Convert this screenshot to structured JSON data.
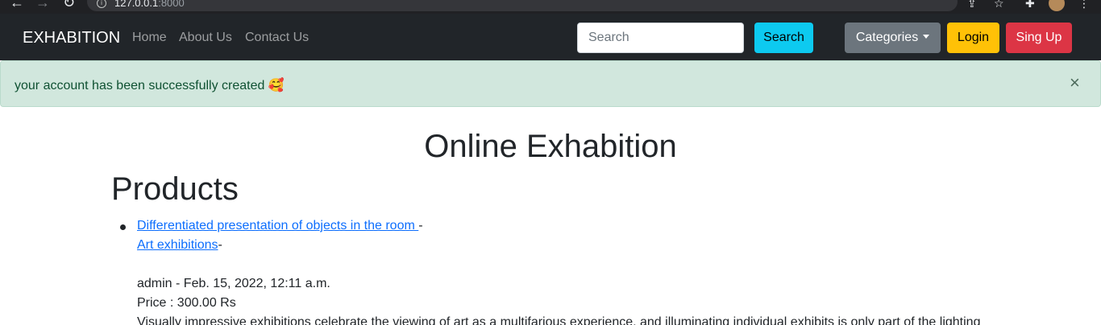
{
  "browser": {
    "url_host": "127.0.0.1",
    "url_port": ":8000"
  },
  "navbar": {
    "brand": "EXHABITION",
    "links": [
      "Home",
      "About Us",
      "Contact Us"
    ],
    "search_placeholder": "Search",
    "search_button": "Search",
    "categories_button": "Categories",
    "login_button": "Login",
    "signup_button": "Sing Up"
  },
  "alert": {
    "message": "your account has been successfully created 🥰",
    "close": "×"
  },
  "main": {
    "title": "Online Exhabition",
    "products_heading": "Products",
    "product": {
      "title_link": "Differentiated presentation of objects in the room ",
      "title_suffix": "-",
      "category_link": "Art exhibitions",
      "category_suffix": "-",
      "meta": "admin - Feb. 15, 2022, 12:11 a.m.",
      "price": "Price : 300.00 Rs",
      "description": "Visually impressive exhibitions celebrate the viewing of art as a multifarious experience, and illuminating individual exhibits is only part of the lighting"
    }
  },
  "colors": {
    "navbar_bg": "#212529",
    "search_btn": "#0dcaf0",
    "categories_btn": "#6c757d",
    "login_btn": "#ffc107",
    "signup_btn": "#dc3545",
    "alert_bg": "#d1e7dd",
    "link": "#0d6efd"
  }
}
